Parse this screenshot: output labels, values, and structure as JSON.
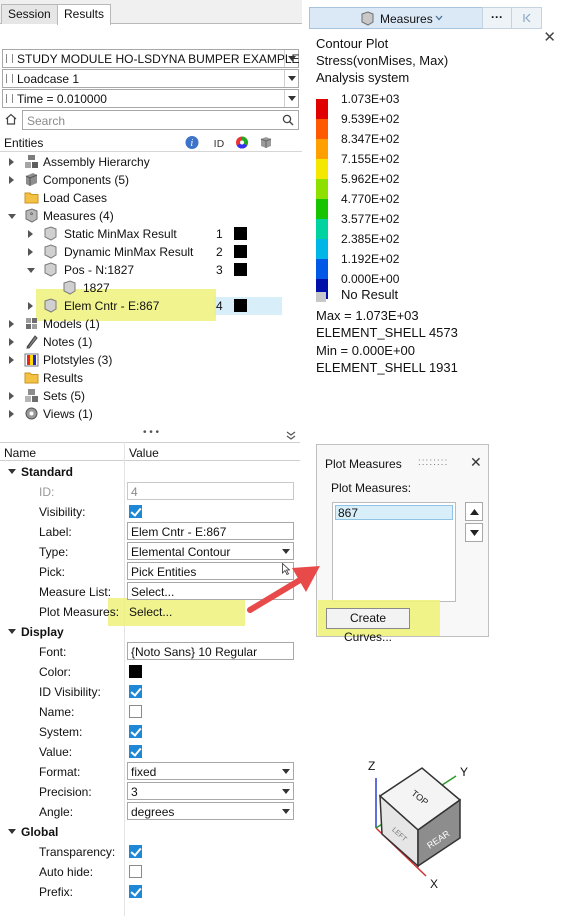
{
  "tabs": [
    {
      "label": "Session"
    },
    {
      "label": "Results"
    }
  ],
  "selectors": {
    "study": "STUDY MODULE HO-LSDYNA BUMPER EXAMPLE",
    "loadcase": "Loadcase 1",
    "time": "Time = 0.010000"
  },
  "search": {
    "placeholder": "Search"
  },
  "entities_header": {
    "label": "Entities"
  },
  "tree": {
    "assembly": "Assembly Hierarchy",
    "components": "Components (5)",
    "loadcases": "Load Cases",
    "measures": "Measures (4)",
    "m1": {
      "label": "Static MinMax Result",
      "id": "1"
    },
    "m2": {
      "label": "Dynamic MinMax Result",
      "id": "2"
    },
    "m3": {
      "label": "Pos -  N:1827",
      "id": "3"
    },
    "m3child": "1827",
    "m4": {
      "label": "Elem Cntr -  E:867",
      "id": "4"
    },
    "models": "Models (1)",
    "notes": "Notes (1)",
    "plotstyles": "Plotstyles (3)",
    "results": "Results",
    "sets": "Sets (5)",
    "views": "Views (1)"
  },
  "prop_header": {
    "name": "Name",
    "value": "Value"
  },
  "standard": {
    "title": "Standard",
    "id_label": "ID:",
    "id_value": "4",
    "visibility_label": "Visibility:",
    "label_label": "Label:",
    "label_value": "Elem Cntr -  E:867",
    "type_label": "Type:",
    "type_value": "Elemental Contour",
    "pick_label": "Pick:",
    "pick_value": "Pick Entities",
    "measure_list_label": "Measure List:",
    "measure_list_value": "Select...",
    "plot_measures_label": "Plot Measures:",
    "plot_measures_value": "Select..."
  },
  "display": {
    "title": "Display",
    "font_label": "Font:",
    "font_value": "{Noto Sans} 10 Regular",
    "color_label": "Color:",
    "idvis_label": "ID Visibility:",
    "name_label": "Name:",
    "system_label": "System:",
    "value_label": "Value:",
    "format_label": "Format:",
    "format_value": "fixed",
    "precision_label": "Precision:",
    "precision_value": "3",
    "angle_label": "Angle:",
    "angle_value": "degrees"
  },
  "global": {
    "title": "Global",
    "transparency_label": "Transparency:",
    "autohide_label": "Auto hide:",
    "prefix_label": "Prefix:"
  },
  "measures_toolbar": {
    "label": "Measures",
    "more": "···"
  },
  "legend": {
    "line1": "Contour Plot",
    "line2": "Stress(vonMises, Max)",
    "line3": "Analysis system",
    "ticks": [
      "1.073E+03",
      "9.539E+02",
      "8.347E+02",
      "7.155E+02",
      "5.962E+02",
      "4.770E+02",
      "3.577E+02",
      "2.385E+02",
      "1.192E+02",
      "0.000E+00"
    ],
    "colors": [
      "#e00000",
      "#ff5a00",
      "#ffa000",
      "#f4e800",
      "#8ee000",
      "#17c400",
      "#00d2a0",
      "#00b6e6",
      "#0058e6",
      "#0010a8"
    ],
    "no_result": "No Result",
    "max": "Max = 1.073E+03",
    "max_elem": "ELEMENT_SHELL 4573",
    "min": "Min = 0.000E+00",
    "min_elem": "ELEMENT_SHELL 1931"
  },
  "plot_dialog": {
    "title": "Plot Measures",
    "grip": "::::::::",
    "label": "Plot Measures:",
    "items": [
      "867"
    ],
    "create": "Create Curves..."
  },
  "cube": {
    "axis_z": "Z",
    "axis_y": "Y",
    "axis_x": "X",
    "top": "TOP",
    "rear": "REAR",
    "left": "LEFT"
  }
}
